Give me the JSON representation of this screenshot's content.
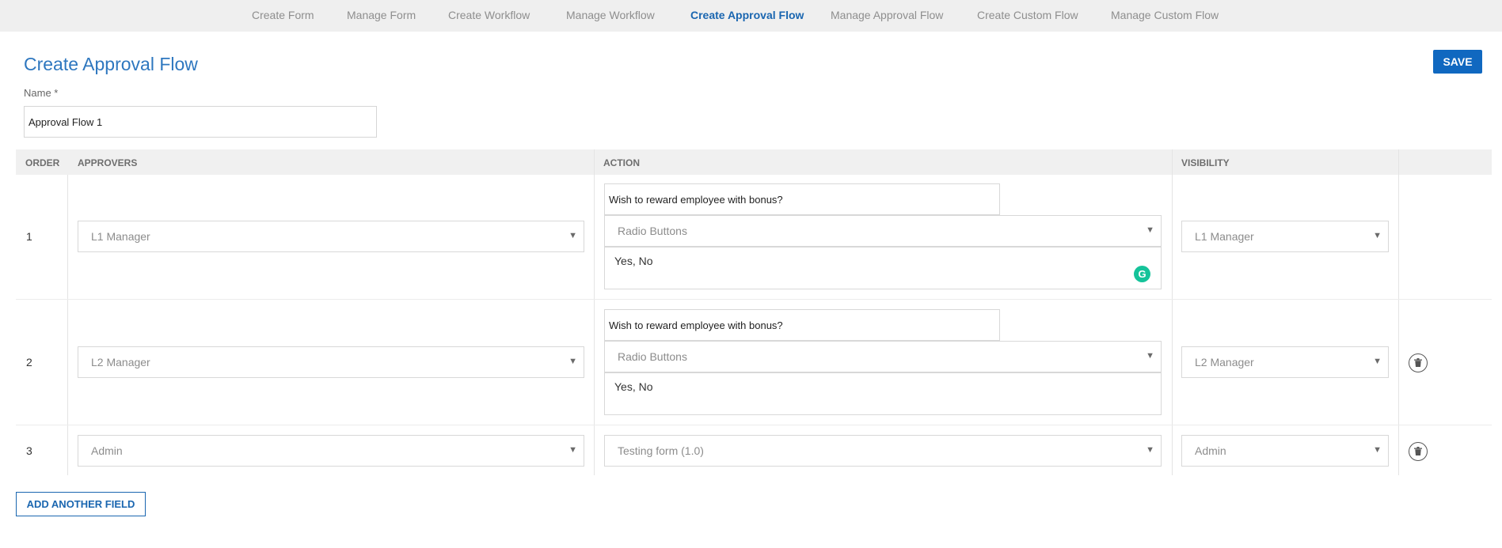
{
  "nav": {
    "items": [
      {
        "label": "Create Form"
      },
      {
        "label": "Manage Form"
      },
      {
        "label": "Create Workflow"
      },
      {
        "label": "Manage Workflow"
      },
      {
        "label": "Create Approval Flow",
        "active": true
      },
      {
        "label": "Manage Approval Flow"
      },
      {
        "label": "Create Custom Flow"
      },
      {
        "label": "Manage Custom Flow"
      }
    ]
  },
  "page": {
    "title": "Create Approval Flow",
    "save_label": "SAVE",
    "name_label": "Name *",
    "name_value": "Approval Flow 1"
  },
  "table": {
    "headers": {
      "order": "ORDER",
      "approvers": "APPROVERS",
      "action": "ACTION",
      "visibility": "VISIBILITY"
    },
    "rows": [
      {
        "order": "1",
        "approver": "L1 Manager",
        "action_question": "Wish to reward employee with bonus?",
        "action_type": "Radio Buttons",
        "action_options": "Yes, No",
        "visibility": "L1 Manager"
      },
      {
        "order": "2",
        "approver": "L2 Manager",
        "action_question": "Wish to reward employee with bonus?",
        "action_type": "Radio Buttons",
        "action_options": "Yes, No",
        "visibility": "L2 Manager"
      },
      {
        "order": "3",
        "approver": "Admin",
        "action_form": "Testing form (1.0)",
        "visibility": "Admin"
      }
    ]
  },
  "footer": {
    "add_label": "ADD ANOTHER FIELD"
  },
  "icons": {
    "caret": "chevron-down-icon",
    "delete": "trash-icon",
    "grammarly": "grammarly-icon"
  },
  "colors": {
    "accent": "#1068c0",
    "active_nav": "#1a66b0",
    "title": "#2e77bf",
    "grammarly": "#15c39a"
  }
}
